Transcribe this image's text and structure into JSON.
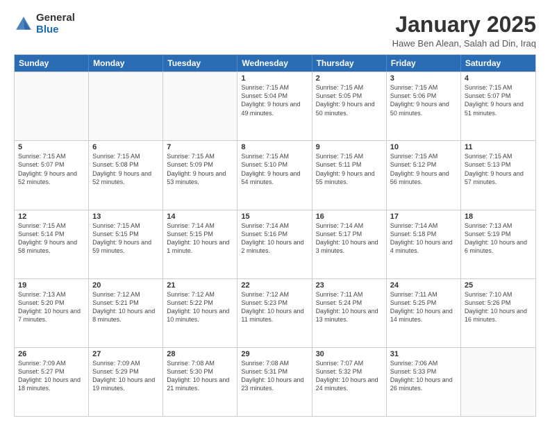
{
  "logo": {
    "general": "General",
    "blue": "Blue"
  },
  "title": "January 2025",
  "location": "Hawe Ben Alean, Salah ad Din, Iraq",
  "days_of_week": [
    "Sunday",
    "Monday",
    "Tuesday",
    "Wednesday",
    "Thursday",
    "Friday",
    "Saturday"
  ],
  "weeks": [
    [
      {
        "day": "",
        "empty": true
      },
      {
        "day": "",
        "empty": true
      },
      {
        "day": "",
        "empty": true
      },
      {
        "day": "1",
        "sunrise": "7:15 AM",
        "sunset": "5:04 PM",
        "daylight": "9 hours and 49 minutes."
      },
      {
        "day": "2",
        "sunrise": "7:15 AM",
        "sunset": "5:05 PM",
        "daylight": "9 hours and 50 minutes."
      },
      {
        "day": "3",
        "sunrise": "7:15 AM",
        "sunset": "5:06 PM",
        "daylight": "9 hours and 50 minutes."
      },
      {
        "day": "4",
        "sunrise": "7:15 AM",
        "sunset": "5:07 PM",
        "daylight": "9 hours and 51 minutes."
      }
    ],
    [
      {
        "day": "5",
        "sunrise": "7:15 AM",
        "sunset": "5:07 PM",
        "daylight": "9 hours and 52 minutes."
      },
      {
        "day": "6",
        "sunrise": "7:15 AM",
        "sunset": "5:08 PM",
        "daylight": "9 hours and 52 minutes."
      },
      {
        "day": "7",
        "sunrise": "7:15 AM",
        "sunset": "5:09 PM",
        "daylight": "9 hours and 53 minutes."
      },
      {
        "day": "8",
        "sunrise": "7:15 AM",
        "sunset": "5:10 PM",
        "daylight": "9 hours and 54 minutes."
      },
      {
        "day": "9",
        "sunrise": "7:15 AM",
        "sunset": "5:11 PM",
        "daylight": "9 hours and 55 minutes."
      },
      {
        "day": "10",
        "sunrise": "7:15 AM",
        "sunset": "5:12 PM",
        "daylight": "9 hours and 56 minutes."
      },
      {
        "day": "11",
        "sunrise": "7:15 AM",
        "sunset": "5:13 PM",
        "daylight": "9 hours and 57 minutes."
      }
    ],
    [
      {
        "day": "12",
        "sunrise": "7:15 AM",
        "sunset": "5:14 PM",
        "daylight": "9 hours and 58 minutes."
      },
      {
        "day": "13",
        "sunrise": "7:15 AM",
        "sunset": "5:15 PM",
        "daylight": "9 hours and 59 minutes."
      },
      {
        "day": "14",
        "sunrise": "7:14 AM",
        "sunset": "5:15 PM",
        "daylight": "10 hours and 1 minute."
      },
      {
        "day": "15",
        "sunrise": "7:14 AM",
        "sunset": "5:16 PM",
        "daylight": "10 hours and 2 minutes."
      },
      {
        "day": "16",
        "sunrise": "7:14 AM",
        "sunset": "5:17 PM",
        "daylight": "10 hours and 3 minutes."
      },
      {
        "day": "17",
        "sunrise": "7:14 AM",
        "sunset": "5:18 PM",
        "daylight": "10 hours and 4 minutes."
      },
      {
        "day": "18",
        "sunrise": "7:13 AM",
        "sunset": "5:19 PM",
        "daylight": "10 hours and 6 minutes."
      }
    ],
    [
      {
        "day": "19",
        "sunrise": "7:13 AM",
        "sunset": "5:20 PM",
        "daylight": "10 hours and 7 minutes."
      },
      {
        "day": "20",
        "sunrise": "7:12 AM",
        "sunset": "5:21 PM",
        "daylight": "10 hours and 8 minutes."
      },
      {
        "day": "21",
        "sunrise": "7:12 AM",
        "sunset": "5:22 PM",
        "daylight": "10 hours and 10 minutes."
      },
      {
        "day": "22",
        "sunrise": "7:12 AM",
        "sunset": "5:23 PM",
        "daylight": "10 hours and 11 minutes."
      },
      {
        "day": "23",
        "sunrise": "7:11 AM",
        "sunset": "5:24 PM",
        "daylight": "10 hours and 13 minutes."
      },
      {
        "day": "24",
        "sunrise": "7:11 AM",
        "sunset": "5:25 PM",
        "daylight": "10 hours and 14 minutes."
      },
      {
        "day": "25",
        "sunrise": "7:10 AM",
        "sunset": "5:26 PM",
        "daylight": "10 hours and 16 minutes."
      }
    ],
    [
      {
        "day": "26",
        "sunrise": "7:09 AM",
        "sunset": "5:27 PM",
        "daylight": "10 hours and 18 minutes."
      },
      {
        "day": "27",
        "sunrise": "7:09 AM",
        "sunset": "5:29 PM",
        "daylight": "10 hours and 19 minutes."
      },
      {
        "day": "28",
        "sunrise": "7:08 AM",
        "sunset": "5:30 PM",
        "daylight": "10 hours and 21 minutes."
      },
      {
        "day": "29",
        "sunrise": "7:08 AM",
        "sunset": "5:31 PM",
        "daylight": "10 hours and 23 minutes."
      },
      {
        "day": "30",
        "sunrise": "7:07 AM",
        "sunset": "5:32 PM",
        "daylight": "10 hours and 24 minutes."
      },
      {
        "day": "31",
        "sunrise": "7:06 AM",
        "sunset": "5:33 PM",
        "daylight": "10 hours and 26 minutes."
      },
      {
        "day": "",
        "empty": true
      }
    ]
  ]
}
